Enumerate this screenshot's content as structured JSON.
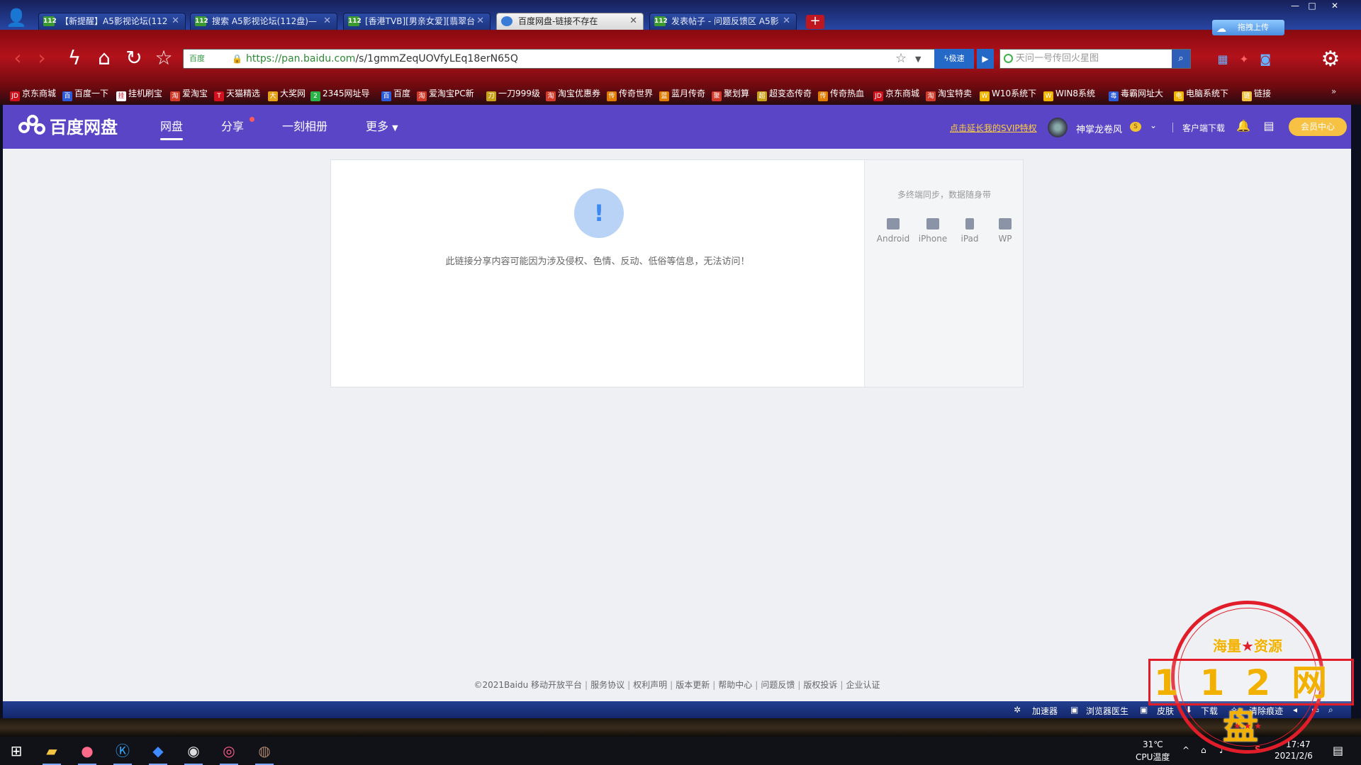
{
  "browser": {
    "tabs": [
      {
        "label": "【新提醒】A5影视论坛(112",
        "fav": "112"
      },
      {
        "label": "搜索 A5影视论坛(112盘)—",
        "fav": "112"
      },
      {
        "label": "[香港TVB][男亲女爱][翡翠台",
        "fav": "112"
      },
      {
        "label": "百度网盘-链接不存在",
        "fav": "",
        "active": true
      },
      {
        "label": "发表帖子 - 问题反馈区 A5影",
        "fav": "112"
      }
    ],
    "upload_label": "拖拽上传",
    "address": {
      "cert": "百度",
      "url_scheme": "https://pan.baidu.com",
      "url_rest": "/s/1gmmZeqUOVfyLEq18erN65Q"
    },
    "speed_label": "极速",
    "search_placeholder": "天问一号传回火星图",
    "bookmarks": [
      {
        "icon": "JD",
        "label": "京东商城",
        "color": "#d0111b"
      },
      {
        "icon": "百",
        "label": "百度一下",
        "color": "#2d5bd6"
      },
      {
        "icon": "挂",
        "label": "挂机刷宝",
        "color": "#ffffff"
      },
      {
        "icon": "淘",
        "label": "爱淘宝",
        "color": "#d23a2a"
      },
      {
        "icon": "T",
        "label": "天猫精选",
        "color": "#d0111b"
      },
      {
        "icon": "大",
        "label": "大奖网",
        "color": "#e6a11a"
      },
      {
        "icon": "2",
        "label": "2345网址导",
        "color": "#2bb34a"
      },
      {
        "icon": "百",
        "label": "百度",
        "color": "#2d5bd6"
      },
      {
        "icon": "淘",
        "label": "爱淘宝PC新",
        "color": "#d23a2a"
      },
      {
        "icon": "刀",
        "label": "一刀999级",
        "color": "#c8a11a"
      },
      {
        "icon": "淘",
        "label": "淘宝优惠券",
        "color": "#d23a2a"
      },
      {
        "icon": "传",
        "label": "传奇世界",
        "color": "#e07b00"
      },
      {
        "icon": "蓝",
        "label": "蓝月传奇",
        "color": "#e07b00"
      },
      {
        "icon": "聚",
        "label": "聚划算",
        "color": "#d23a2a"
      },
      {
        "icon": "超",
        "label": "超变态传奇",
        "color": "#c8a11a"
      },
      {
        "icon": "传",
        "label": "传奇热血",
        "color": "#e07b00"
      },
      {
        "icon": "JD",
        "label": "京东商城",
        "color": "#d0111b"
      },
      {
        "icon": "淘",
        "label": "淘宝特卖",
        "color": "#d23a2a"
      },
      {
        "icon": "W",
        "label": "W10系统下",
        "color": "#f0b400"
      },
      {
        "icon": "W",
        "label": "WIN8系统",
        "color": "#f0b400"
      },
      {
        "icon": "毒",
        "label": "毒霸网址大",
        "color": "#2d5bd6"
      },
      {
        "icon": "电",
        "label": "电脑系统下",
        "color": "#f0b400"
      },
      {
        "icon": "链",
        "label": "链接",
        "color": "#f0c040"
      }
    ]
  },
  "app": {
    "logo_text": "百度网盘",
    "nav": [
      "网盘",
      "分享",
      "一刻相册",
      "更多"
    ],
    "svip_link": "点击延长我的SVIP特权",
    "username": "神掌龙卷风",
    "vip_badge": "S",
    "client_download": "客户端下载",
    "vip_center": "会员中心"
  },
  "error": {
    "icon": "!",
    "message": "此链接分享内容可能因为涉及侵权、色情、反动、低俗等信息，无法访问！"
  },
  "side": {
    "sync_text": "多终端同步，数据随身带",
    "platforms": [
      "Android",
      "iPhone",
      "iPad",
      "WP"
    ]
  },
  "footer": {
    "copyright": "©2021Baidu",
    "links": [
      "移动开放平台",
      "服务协议",
      "权利声明",
      "版本更新",
      "帮助中心",
      "问题反馈",
      "版权投诉",
      "企业认证"
    ]
  },
  "statusbar": {
    "items": [
      "加速器",
      "浏览器医生",
      "皮肤",
      "下载",
      "清除痕迹"
    ]
  },
  "taskbar": {
    "temp": "31℃",
    "temp_label": "CPU温度",
    "time": "17:47",
    "date": "2021/2/6"
  },
  "stamp": {
    "top_left": "海量",
    "top_star": "★",
    "top_right": "资源",
    "main": "112网盘",
    "stars": "★ ★ ★"
  }
}
